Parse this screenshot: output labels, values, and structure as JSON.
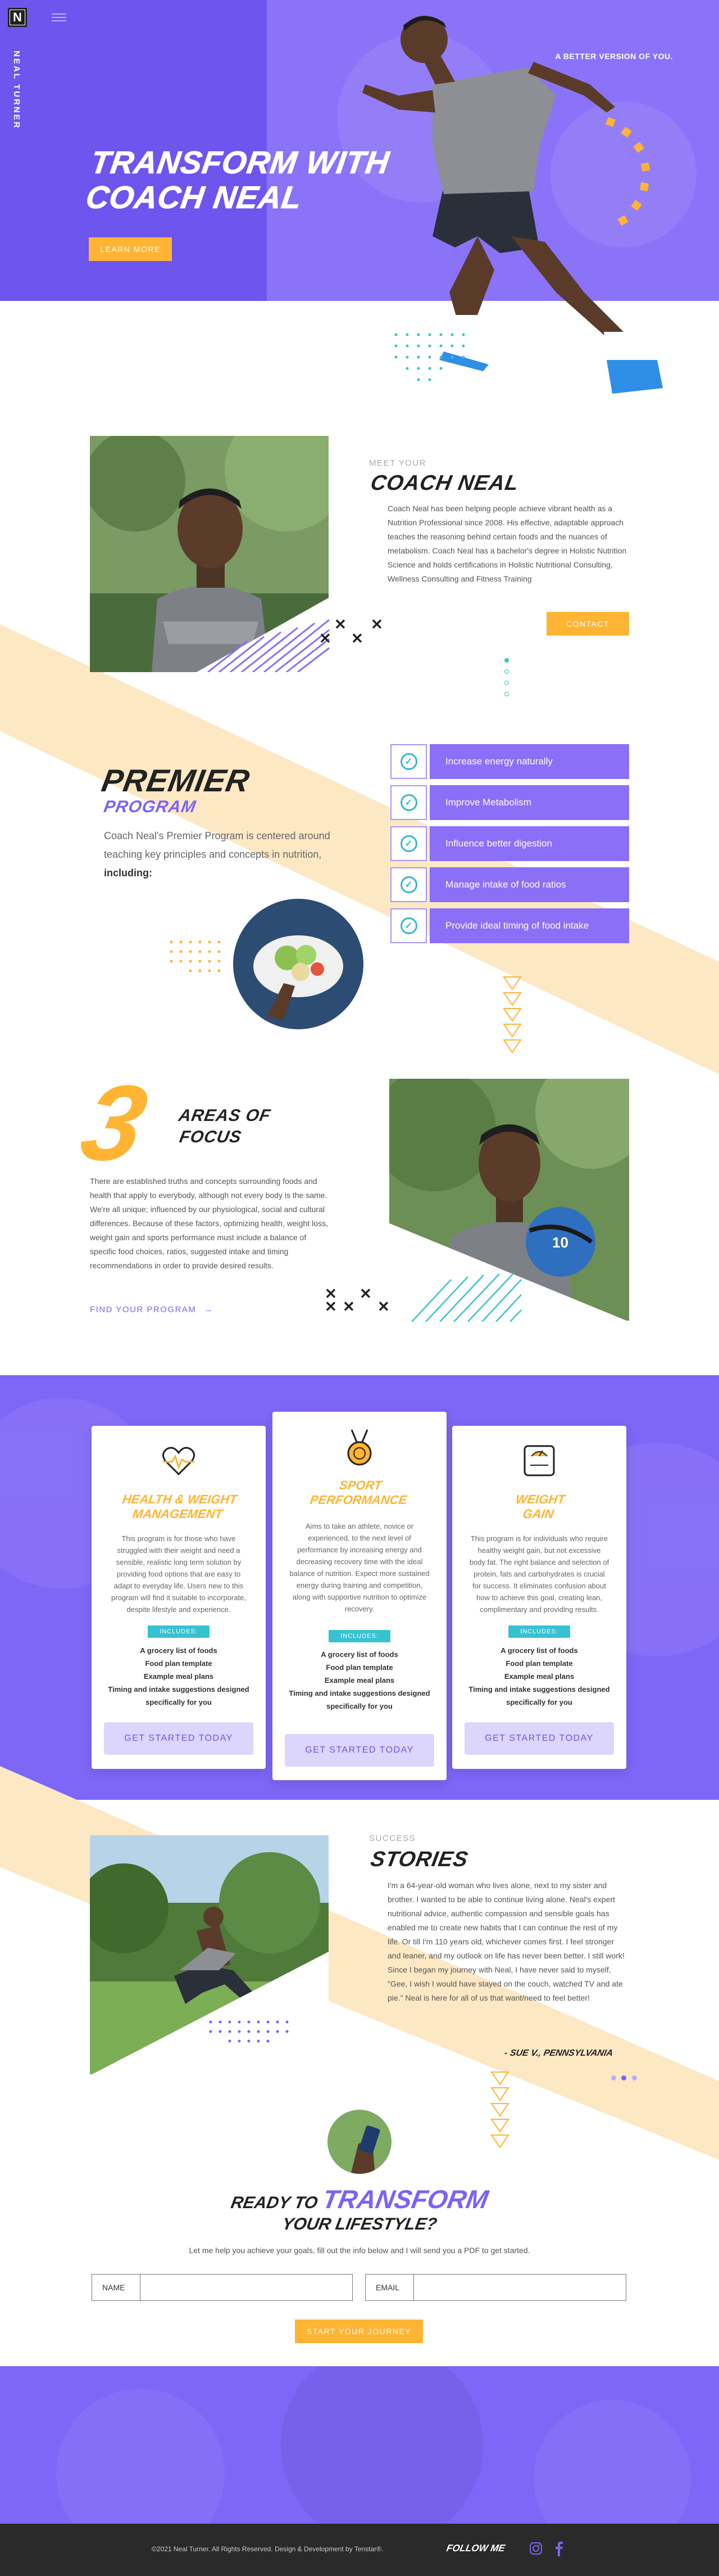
{
  "brand": {
    "logo_letter": "N",
    "vertical_name": "NEAL TURNER"
  },
  "hero": {
    "tagline": "A BETTER VERSION OF YOU.",
    "title_line1": "TRANSFORM WITH",
    "title_line2": "COACH NEAL",
    "cta_label": "LEARN MORE"
  },
  "about": {
    "eyebrow": "MEET YOUR",
    "title": "COACH NEAL",
    "body": "Coach Neal has been helping people achieve vibrant health as a Nutrition Professional since 2008. His effective, adaptable approach teaches the reasoning behind certain foods and the nuances of metabolism. Coach Neal has a bachelor's degree in Holistic Nutrition Science and holds certifications in Holistic Nutritional Consulting, Wellness Consulting and Fitness Training",
    "contact_label": "CONTACT"
  },
  "premier": {
    "title_line1": "PREMIER",
    "title_line2": "PROGRAM",
    "intro": "Coach Neal's Premier Program is centered around teaching key principles and concepts in nutrition,",
    "intro_bold": "including:",
    "items": [
      "Increase energy naturally",
      "Improve Metabolism",
      "Influence better digestion",
      "Manage intake of food ratios",
      "Provide ideal timing of food intake"
    ]
  },
  "areas": {
    "number": "3",
    "title_line1": "AREAS OF",
    "title_line2": "FOCUS",
    "body": "There are established truths and concepts surrounding foods and health that apply to everybody, although not every body is the same. We're all unique; influenced by our physiological, social and cultural differences. Because of these factors, optimizing health, weight loss, weight gain and sports performance must include a balance of specific food choices, ratios, suggested intake and timing recommendations in order to provide desired results.",
    "link_label": "FIND YOUR PROGRAM"
  },
  "programs": {
    "includes_label": "INCLUDES:",
    "includes": [
      "A grocery list of foods",
      "Food plan template",
      "Example meal plans",
      "Timing and intake suggestions designed specifically for you"
    ],
    "cards": [
      {
        "icon": "heart-rate-icon",
        "title_line1": "HEALTH & WEIGHT",
        "title_line2": "MANAGEMENT",
        "desc": "This program is for those who have struggled with their weight and need a sensible, realistic long term solution by providing food options that are easy to adapt to everyday life. Users new to this program will find it suitable to incorporate, despite lifestyle and experience.",
        "button": "GET STARTED TODAY"
      },
      {
        "icon": "medal-icon",
        "title_line1": "SPORT",
        "title_line2": "PERFORMANCE",
        "desc": "Aims to take an athlete, novice or experienced, to the next level of performance by increasing energy and decreasing recovery time with the ideal balance of nutrition. Expect more sustained energy during training and competition, along with supportive nutrition to optimize recovery.",
        "button": "GET STARTED TODAY"
      },
      {
        "icon": "scale-icon",
        "title_line1": "WEIGHT",
        "title_line2": "GAIN",
        "desc": "This program is for individuals who require healthy weight gain, but not excessive body fat. The right balance and selection of protein, fats and carbohydrates is crucial for success. It eliminates confusion about how to achieve this goal, creating lean, complimentary and providing results.",
        "button": "GET STARTED TODAY"
      }
    ]
  },
  "stories": {
    "eyebrow": "SUCCESS",
    "title": "STORIES",
    "quote": "I'm a 64-year-old woman who lives alone, next to my sister and brother. I wanted to be able to continue living alone. Neal's expert nutritional advice, authentic compassion and sensible goals has enabled me to create new habits that I can continue the rest of my life. Or till I'm 110 years old, whichever comes first. I feel stronger and leaner, and my outlook on life has never been better. I still work! Since I began my journey with Neal, I have never said to myself, \"Gee, I wish I would have stayed on the couch, watched TV and ate pie.\" Neal is here for all of us that want/need to feel better!",
    "author": "- SUE V., PENNSYLVANIA"
  },
  "cta": {
    "line1_pre": "READY TO",
    "line1_accent": "TRANSFORM",
    "line2": "YOUR LIFESTYLE?",
    "subtitle": "Let me help you achieve your goals, fill out the info below and I will send you a PDF to get started.",
    "name_label": "NAME",
    "email_label": "EMAIL",
    "button": "START YOUR JOURNEY"
  },
  "footer": {
    "copyright": "©2021 Neal Turner. All Rights Reserved. Design & Development by Tenstar®.",
    "follow_label": "FOLLOW ME"
  },
  "colors": {
    "purple": "#7b63f7",
    "yellow": "#ffb433",
    "teal": "#37c2d2",
    "cream": "#fde8c4",
    "dark": "#2a2a2a"
  }
}
